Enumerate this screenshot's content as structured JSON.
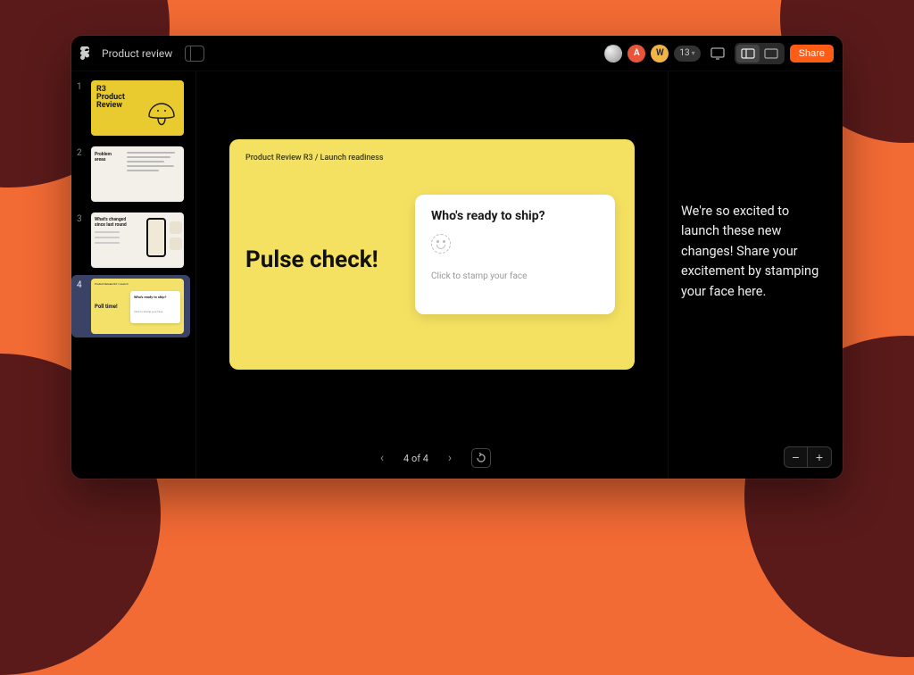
{
  "doc": {
    "title": "Product review"
  },
  "toolbar": {
    "avatars": [
      {
        "label": ""
      },
      {
        "label": "A"
      },
      {
        "label": "W"
      }
    ],
    "viewer_count": "13",
    "share_label": "Share"
  },
  "thumbs": {
    "items": [
      {
        "num": "1",
        "title_lines": "R3\nProduct\nReview"
      },
      {
        "num": "2",
        "title": "Problem\nareas"
      },
      {
        "num": "3",
        "title": "What's changed\nsince last round"
      },
      {
        "num": "4",
        "headline": "Poll time!",
        "card_q": "Who's ready to ship?",
        "card_hint": "Click to stamp your face"
      }
    ]
  },
  "slide": {
    "breadcrumb": "Product Review R3 / Launch readiness",
    "headline": "Pulse check!",
    "poll": {
      "question": "Who's ready to ship?",
      "hint": "Click to stamp your face"
    }
  },
  "pager": {
    "label": "4 of 4"
  },
  "notes": {
    "text": "We're so excited to launch these new changes! Share your excitement by stamping your face here."
  },
  "zoom": {
    "minus": "−",
    "plus": "+"
  }
}
